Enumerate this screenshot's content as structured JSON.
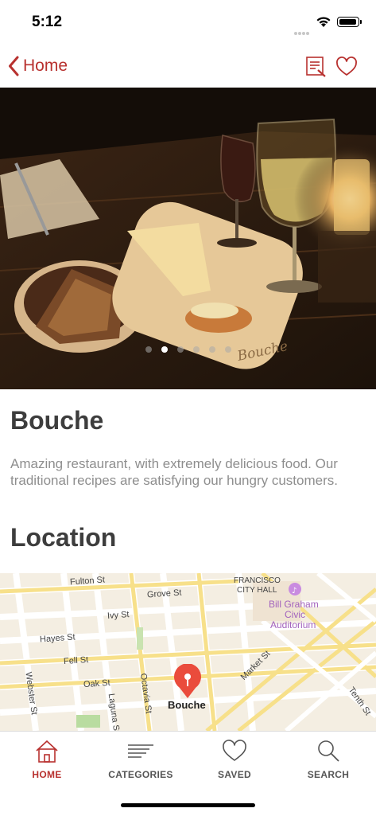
{
  "status_bar": {
    "time": "5:12"
  },
  "nav": {
    "back_label": "Home"
  },
  "hero": {
    "page_count": 6,
    "active_page": 1,
    "plate_text": "Bouche"
  },
  "restaurant": {
    "name": "Bouche",
    "description": "Amazing restaurant, with extremely delicious food. Our traditional recipes are satisfying our hungry customers."
  },
  "location": {
    "heading": "Location",
    "pin_label": "Bouche",
    "streets": {
      "fulton": "Fulton St",
      "grove": "Grove St",
      "ivy": "Ivy St",
      "hayes": "Hayes St",
      "fell": "Fell St",
      "oak": "Oak St",
      "webster": "Webster St",
      "laguna": "Laguna St",
      "octavia": "Octavia St",
      "market": "Market St",
      "tenth": "Tenth St"
    },
    "poi": {
      "city_hall_1": "FRANCISCO",
      "city_hall_2": "CITY HALL",
      "auditorium_1": "Bill Graham",
      "auditorium_2": "Civic",
      "auditorium_3": "Auditorium"
    }
  },
  "tabs": [
    {
      "label": "HOME",
      "icon": "home-icon",
      "active": true
    },
    {
      "label": "CATEGORIES",
      "icon": "categories-icon",
      "active": false
    },
    {
      "label": "SAVED",
      "icon": "heart-icon",
      "active": false
    },
    {
      "label": "SEARCH",
      "icon": "search-icon",
      "active": false
    }
  ],
  "colors": {
    "accent": "#b8312f",
    "text_dark": "#3d3d3d",
    "text_muted": "#8e8e8e",
    "pin": "#ea4c3c"
  }
}
